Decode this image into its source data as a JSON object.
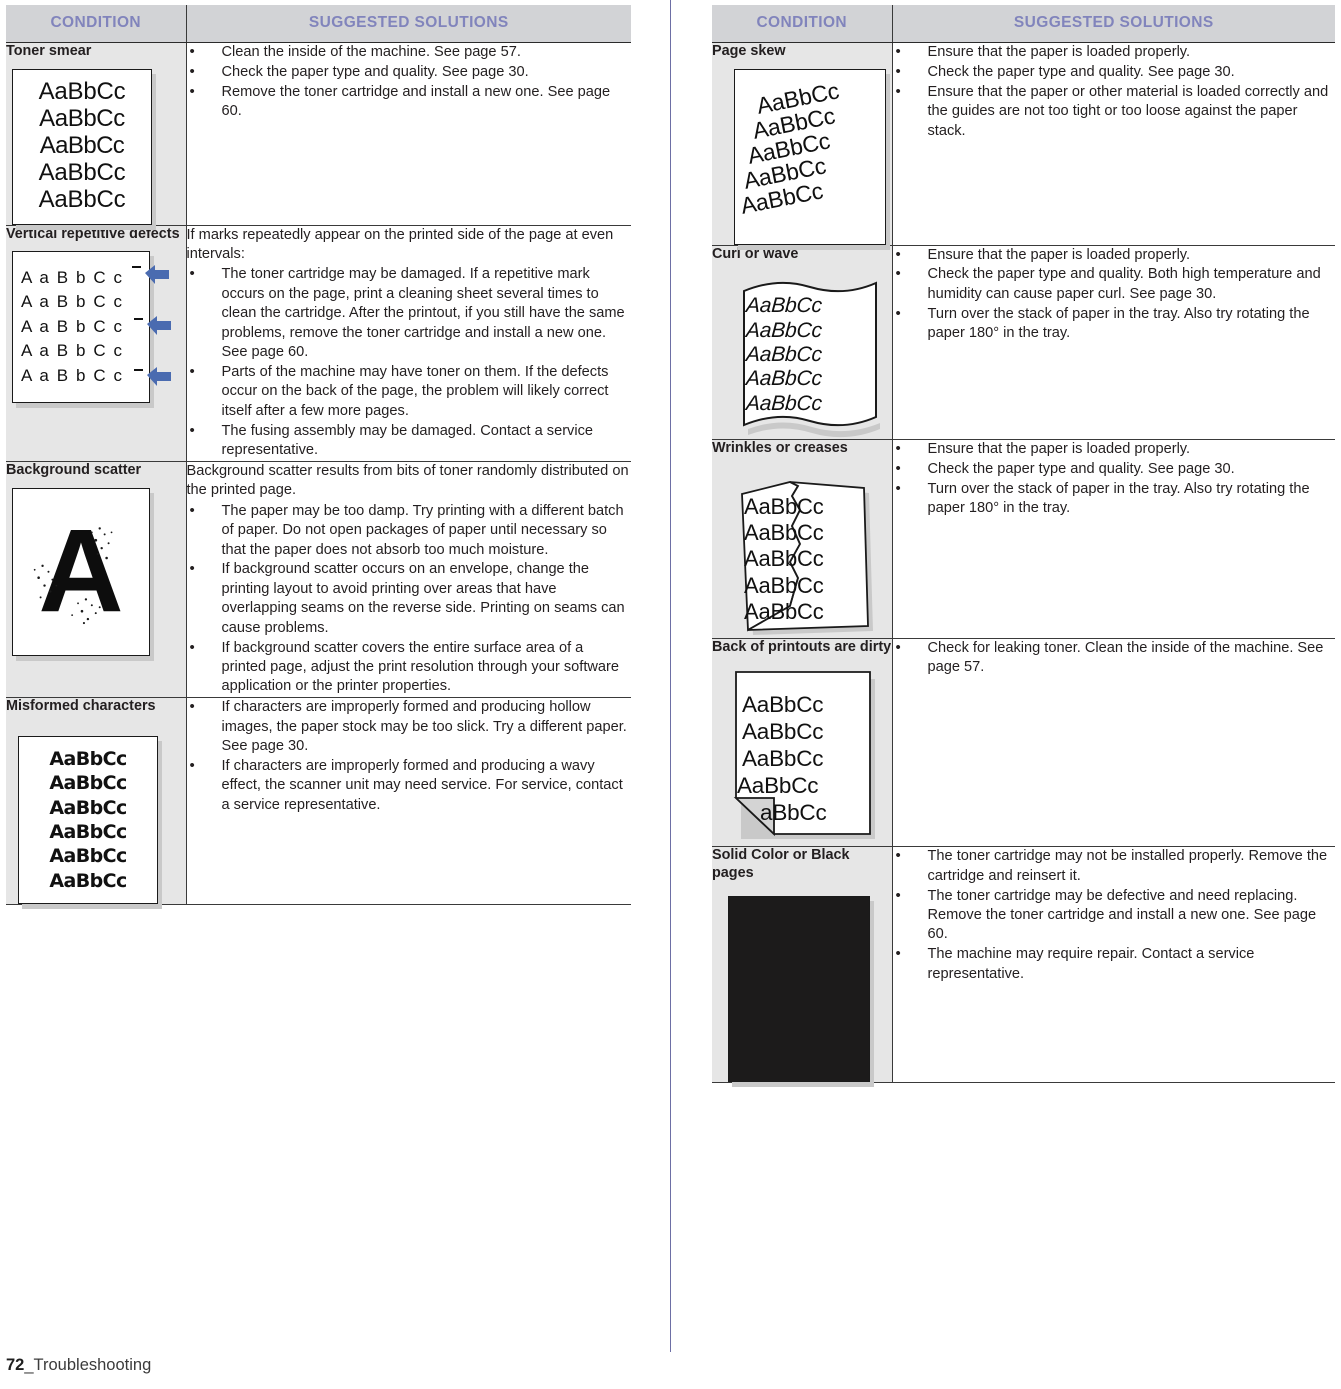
{
  "footer": {
    "page_number": "72",
    "section": "_Troubleshooting"
  },
  "colors": {
    "header_text": "#8184bc",
    "header_bg": "#d2d3d6",
    "condition_bg": "#e6e6e6",
    "arrow_blue": "#4a6bb0",
    "black_page": "#1c1b1b"
  },
  "table_headers": {
    "condition": "CONDITION",
    "solutions": "SUGGESTED SOLUTIONS"
  },
  "sample_text": {
    "aabbcc": "AaBbCc",
    "spaced": "A a B b C c",
    "letter_a": "A",
    "partial": "aBbCc",
    "wrinkle": "AaBbCc"
  },
  "left_table": {
    "header": {
      "condition": "CONDITION",
      "solutions": "SUGGESTED SOLUTIONS"
    },
    "rows": [
      {
        "condition": "Toner smear",
        "sample": "toner-smear-sample",
        "intro": "",
        "bullets": [
          "Clean the inside of the machine. See page 57.",
          "Check the paper type and quality. See page 30.",
          "Remove the toner cartridge and install a new one. See page 60."
        ]
      },
      {
        "condition": "Vertical repetitive defects",
        "sample": "vertical-repetitive-defects-sample",
        "intro": "If marks repeatedly appear on the printed side of the page at even intervals:",
        "bullets": [
          "The toner cartridge may be damaged. If a repetitive mark occurs on the page, print a cleaning sheet several times to clean the cartridge. After the printout, if you still have the same problems, remove the toner cartridge and install a new one. See page 60.",
          "Parts of the machine may have toner on them. If the defects occur on the back of the page, the problem will likely correct itself after a few more pages.",
          "The fusing assembly may be damaged. Contact a service representative."
        ]
      },
      {
        "condition": "Background scatter",
        "sample": "background-scatter-sample",
        "intro": "Background scatter results from bits of toner randomly distributed on the printed page.",
        "bullets": [
          "The paper may be too damp. Try printing with a different batch of paper. Do not open packages of paper until necessary so that the paper does not absorb too much moisture.",
          "If background scatter occurs on an envelope, change the printing layout to avoid printing over areas that have overlapping seams on the reverse side. Printing on seams can cause problems.",
          "If background scatter covers the entire surface area of a printed page, adjust the print resolution through your software application or the printer properties."
        ]
      },
      {
        "condition": "Misformed characters",
        "sample": "misformed-characters-sample",
        "intro": "",
        "bullets": [
          "If characters are improperly formed and producing hollow images, the paper stock may be too slick. Try a different paper. See page 30.",
          "If characters are improperly formed and producing a wavy effect, the scanner unit may need service. For service, contact a service representative."
        ]
      }
    ]
  },
  "right_table": {
    "header": {
      "condition": "CONDITION",
      "solutions": "SUGGESTED SOLUTIONS"
    },
    "rows": [
      {
        "condition": "Page skew",
        "sample": "page-skew-sample",
        "intro": "",
        "bullets": [
          "Ensure that the paper is loaded properly.",
          "Check the paper type and quality. See page 30.",
          "Ensure that the paper or other material is loaded correctly and the guides are not too tight or too loose against the paper stack."
        ]
      },
      {
        "condition": "Curl or wave",
        "sample": "curl-or-wave-sample",
        "intro": "",
        "bullets": [
          "Ensure that the paper is loaded properly.",
          "Check the paper type and quality. Both high temperature and humidity can cause paper curl. See page 30.",
          "Turn over the stack of paper in the tray. Also try rotating the paper 180° in the tray."
        ]
      },
      {
        "condition": "Wrinkles or creases",
        "sample": "wrinkles-or-creases-sample",
        "intro": "",
        "bullets": [
          "Ensure that the paper is loaded properly.",
          "Check the paper type and quality. See page 30.",
          "Turn over the stack of paper in the tray. Also try rotating the paper 180° in the tray."
        ]
      },
      {
        "condition": "Back of printouts are dirty",
        "sample": "back-of-printouts-dirty-sample",
        "intro": "",
        "bullets": [
          "Check for leaking toner. Clean the inside of the machine. See page 57."
        ]
      },
      {
        "condition": "Solid Color or Black pages",
        "sample": "solid-black-page-sample",
        "intro": "",
        "bullets": [
          "The toner cartridge may not be installed properly. Remove the cartridge and reinsert it.",
          "The toner cartridge may be defective and need replacing. Remove the toner cartridge and install a new one. See page 60.",
          "The machine may require repair. Contact a service representative."
        ]
      }
    ]
  }
}
